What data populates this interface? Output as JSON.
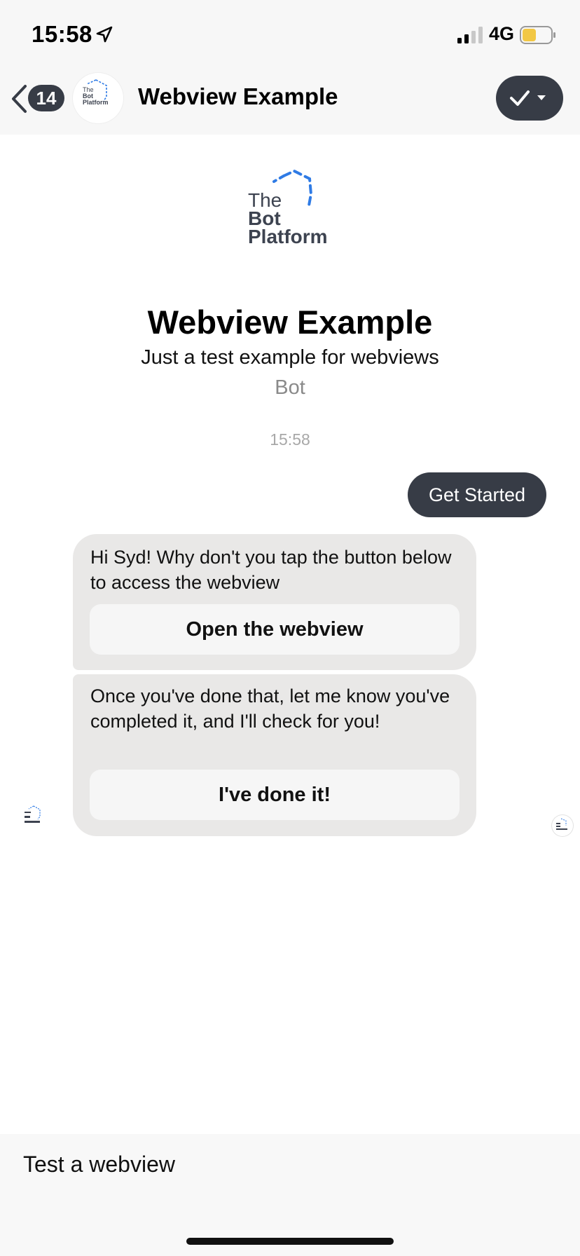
{
  "status_bar": {
    "time": "15:58",
    "network": "4G",
    "icons": [
      "location-arrow-icon",
      "signal-icon",
      "battery-icon"
    ],
    "battery_color": "#f2c744"
  },
  "header": {
    "back_badge": "14",
    "title": "Webview Example",
    "avatar_logo": {
      "line1": "The",
      "line2": "Bot",
      "line3": "Platform"
    },
    "done_icon": "checkmark-icon",
    "dropdown_icon": "caret-down-icon"
  },
  "profile": {
    "logo": {
      "line1": "The",
      "line2": "Bot",
      "line3": "Platform"
    },
    "title": "Webview Example",
    "subtitle": "Just a test example for webviews",
    "kind": "Bot"
  },
  "conversation": {
    "timestamp": "15:58",
    "outgoing_message": "Get Started",
    "bot_messages": [
      {
        "text": "Hi Syd! Why don't you tap the button below to access the webview",
        "button": "Open the webview"
      },
      {
        "text": "Once you've done that, let me know you've completed it, and I'll check for you!",
        "button": "I've done it!"
      }
    ]
  },
  "composer": {
    "text": "Test a webview"
  },
  "colors": {
    "dark": "#373c46",
    "bubble_gray": "#e9e8e7",
    "logo_blue": "#2f7be5",
    "logo_text": "#3d4350"
  }
}
